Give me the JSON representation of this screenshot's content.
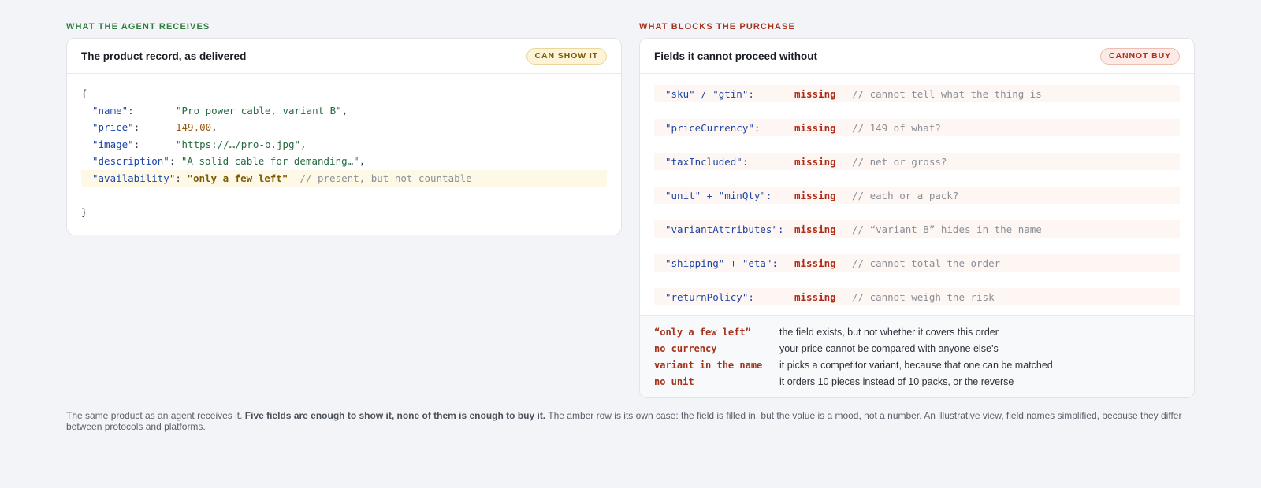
{
  "left": {
    "eyebrow": "What the agent receives",
    "title": "The product record, as delivered",
    "badge": "Can show it",
    "code": {
      "open": "{",
      "close": "}",
      "lines": [
        {
          "key": "\"name\"",
          "value": "\"Pro power cable, variant B\"",
          "kind": "string"
        },
        {
          "key": "\"price\"",
          "value": "149.00",
          "kind": "number"
        },
        {
          "key": "\"image\"",
          "value": "\"https://…/pro-b.jpg\"",
          "kind": "string"
        },
        {
          "key": "\"description\"",
          "value": "\"A solid cable for demanding…\"",
          "kind": "string"
        },
        {
          "key": "\"availability\"",
          "value": "\"only a few left\"",
          "comment": "// present, but not countable",
          "kind": "highlight"
        }
      ]
    }
  },
  "right": {
    "eyebrow": "What blocks the purchase",
    "title": "Fields it cannot proceed without",
    "badge": "Cannot buy",
    "rows": [
      {
        "field": "\"sku\" / \"gtin\":",
        "status": "missing",
        "comment": "// cannot tell what the thing is"
      },
      {
        "field": "\"priceCurrency\":",
        "status": "missing",
        "comment": "// 149 of what?"
      },
      {
        "field": "\"taxIncluded\":",
        "status": "missing",
        "comment": "// net or gross?"
      },
      {
        "field": "\"unit\" + \"minQty\":",
        "status": "missing",
        "comment": "// each or a pack?"
      },
      {
        "field": "\"variantAttributes\":",
        "status": "missing",
        "comment": "// “variant B” hides in the name"
      },
      {
        "field": "\"shipping\" + \"eta\":",
        "status": "missing",
        "comment": "// cannot total the order"
      },
      {
        "field": "\"returnPolicy\":",
        "status": "missing",
        "comment": "// cannot weigh the risk"
      }
    ],
    "legend": [
      {
        "term": "“only a few left”",
        "desc": "the field exists, but not whether it covers this order"
      },
      {
        "term": "no currency",
        "desc": "your price cannot be compared with anyone else’s"
      },
      {
        "term": "variant in the name",
        "desc": "it picks a competitor variant, because that one can be matched"
      },
      {
        "term": "no unit",
        "desc": "it orders 10 pieces instead of 10 packs, or the reverse"
      }
    ]
  },
  "caption": {
    "lead": "The same product as an agent receives it.",
    "bold": "Five fields are enough to show it, none of them is enough to buy it.",
    "rest": "The amber row is its own case: the field is filled in, but the value is a mood, not a number. An illustrative view, field names simplified, because they differ between protocols and platforms."
  },
  "colors": {
    "green_label": "#2e7d3e",
    "red_label": "#a5321c",
    "missing": "#b02a18",
    "json_key": "#1d46a6",
    "json_string": "#256a40",
    "json_number": "#9a5a14",
    "amber_highlight": "#fef9e6"
  }
}
